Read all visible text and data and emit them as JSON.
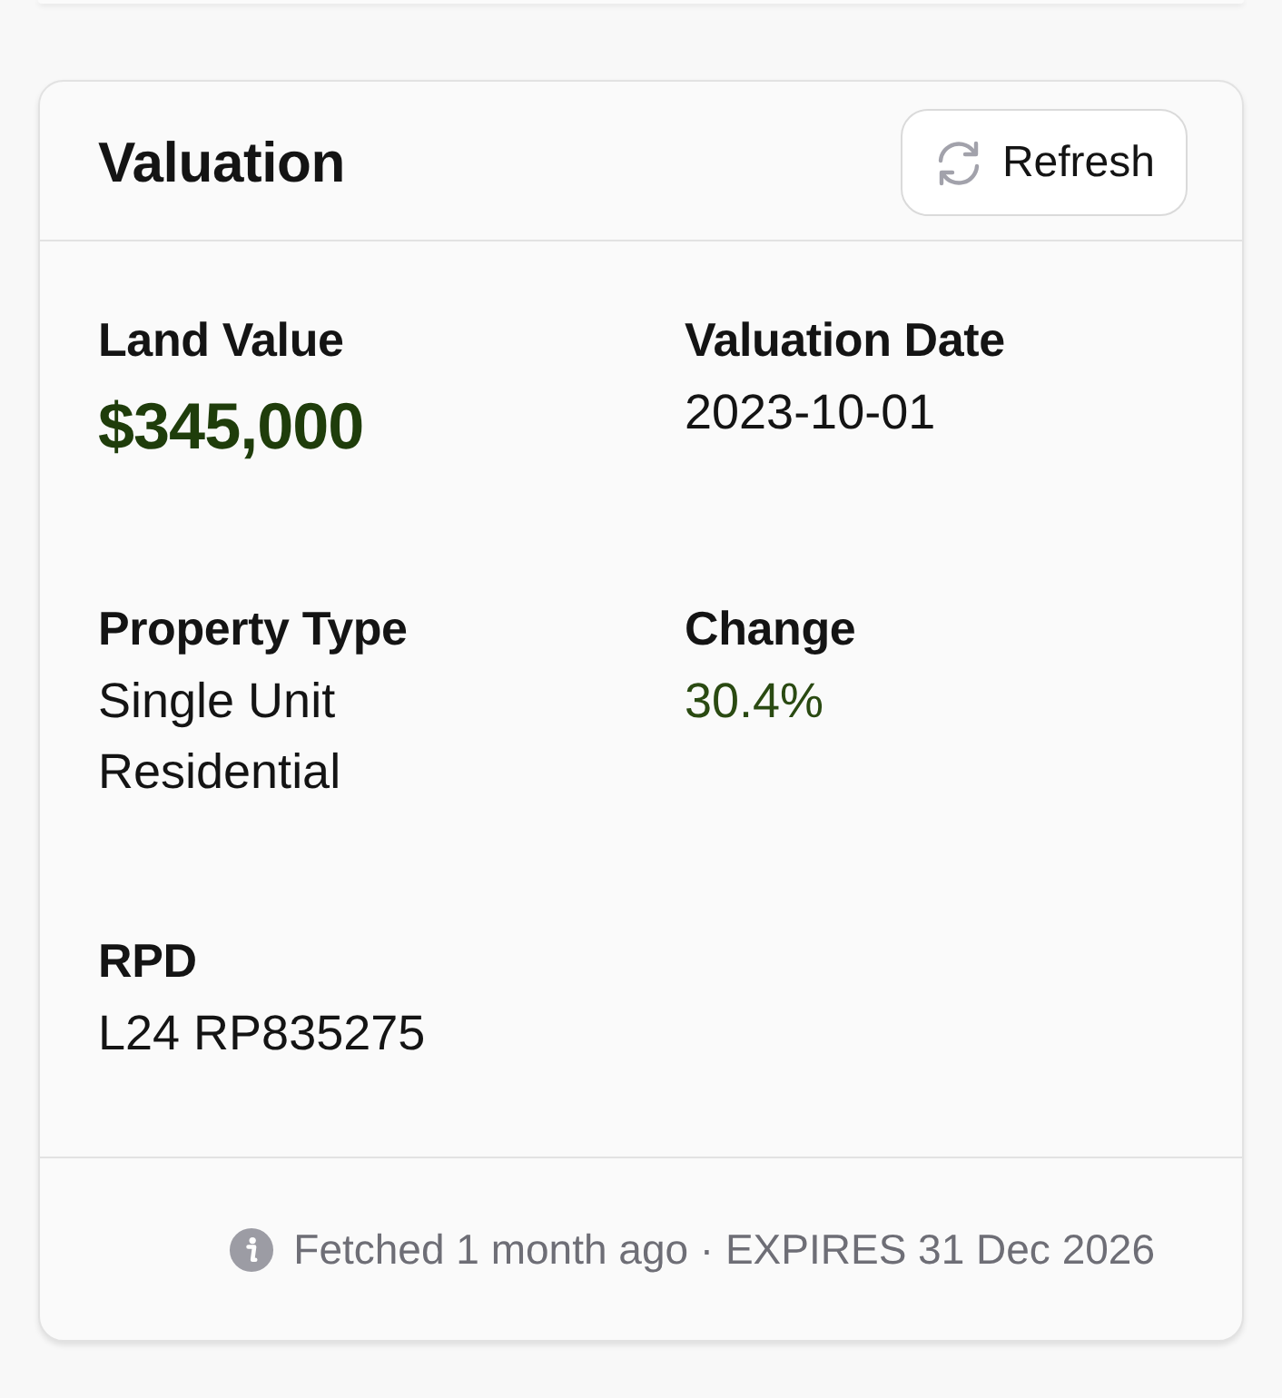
{
  "card": {
    "title": "Valuation",
    "refresh_button": {
      "label": "Refresh"
    },
    "fields": [
      {
        "label": "Land Value",
        "value": "$345,000",
        "kind": "amount"
      },
      {
        "label": "Valuation Date",
        "value": "2023-10-01",
        "kind": "text"
      },
      {
        "label": "Property Type",
        "value": "Single Unit Residential",
        "kind": "text"
      },
      {
        "label": "Change",
        "value": "30.4%",
        "kind": "change"
      },
      {
        "label": "RPD",
        "value": "L24 RP835275",
        "kind": "text"
      }
    ],
    "footer": {
      "note": "Fetched 1 month ago · EXPIRES 31 Dec 2026"
    }
  }
}
